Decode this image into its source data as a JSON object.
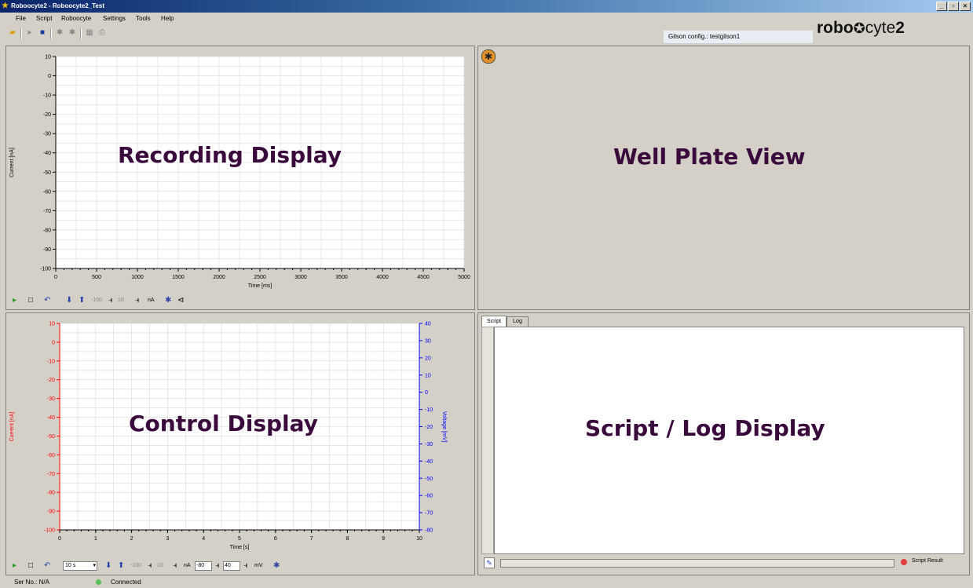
{
  "window": {
    "title": "Roboocyte2 - Roboocyte2_Test",
    "controls": [
      "_",
      "ə",
      "x"
    ]
  },
  "menu": [
    "File",
    "Script",
    "Roboocyte",
    "Settings",
    "Tools",
    "Help"
  ],
  "gilson": "Gilson config.: testgilson1",
  "logo": {
    "pre": "robo",
    "post": "cyte",
    "num": "2"
  },
  "recording": {
    "overlay": "Recording Display",
    "ylabel": "Current [nA]",
    "xlabel": "Time [ms]",
    "controls": {
      "ymin": "-100",
      "ymax": "10",
      "unit": "nA"
    }
  },
  "wellplate": {
    "overlay": "Well Plate View"
  },
  "control": {
    "overlay": "Control Display",
    "ylabel_left": "Current [nA]",
    "ylabel_right": "Voltage [mV]",
    "xlabel": "Time [s]",
    "controls": {
      "range": "10 s",
      "ymin": "-100",
      "ymax": "10",
      "unit_a": "nA",
      "vmin": "-80",
      "vmax": "40",
      "unit_v": "mV"
    }
  },
  "scriptlog": {
    "overlay": "Script / Log Display",
    "tabs": [
      "Script",
      "Log"
    ],
    "result": "Script Result"
  },
  "status": {
    "serial": "Ser No.: N/A",
    "connection": "Connected"
  },
  "colors": {
    "plot_grid": "#d8d8d8",
    "current_axis": "#ff0000",
    "voltage_axis": "#0000ff",
    "overlay_text": "#3b0a3c"
  },
  "chart_data": [
    {
      "type": "line",
      "title": "",
      "xlabel": "Time [ms]",
      "ylabel": "Current [nA]",
      "xlim": [
        0,
        5000
      ],
      "ylim": [
        -100,
        10
      ],
      "x_ticks": [
        "0",
        "500",
        "1000",
        "1500",
        "2000",
        "2500",
        "3000",
        "3500",
        "4000",
        "4500",
        "5000"
      ],
      "y_ticks": [
        "10",
        "0",
        "-10",
        "-20",
        "-30",
        "-40",
        "-50",
        "-60",
        "-70",
        "-80",
        "-90",
        "-100"
      ],
      "series": [],
      "grid": true
    },
    {
      "type": "line",
      "title": "",
      "xlabel": "Time [s]",
      "ylabel": "Current [nA]",
      "y2label": "Voltage [mV]",
      "xlim": [
        0,
        10
      ],
      "ylim": [
        -100,
        10
      ],
      "y2lim": [
        -80,
        40
      ],
      "x_ticks": [
        "0",
        "1",
        "2",
        "3",
        "4",
        "5",
        "6",
        "7",
        "8",
        "9",
        "10"
      ],
      "y_ticks": [
        "10",
        "0",
        "-10",
        "-20",
        "-30",
        "-40",
        "-50",
        "-60",
        "-70",
        "-80",
        "-90",
        "-100"
      ],
      "y2_ticks": [
        "40",
        "30",
        "20",
        "10",
        "0",
        "-10",
        "-20",
        "-30",
        "-40",
        "-50",
        "-60",
        "-70",
        "-80"
      ],
      "series": [],
      "grid": true
    }
  ]
}
